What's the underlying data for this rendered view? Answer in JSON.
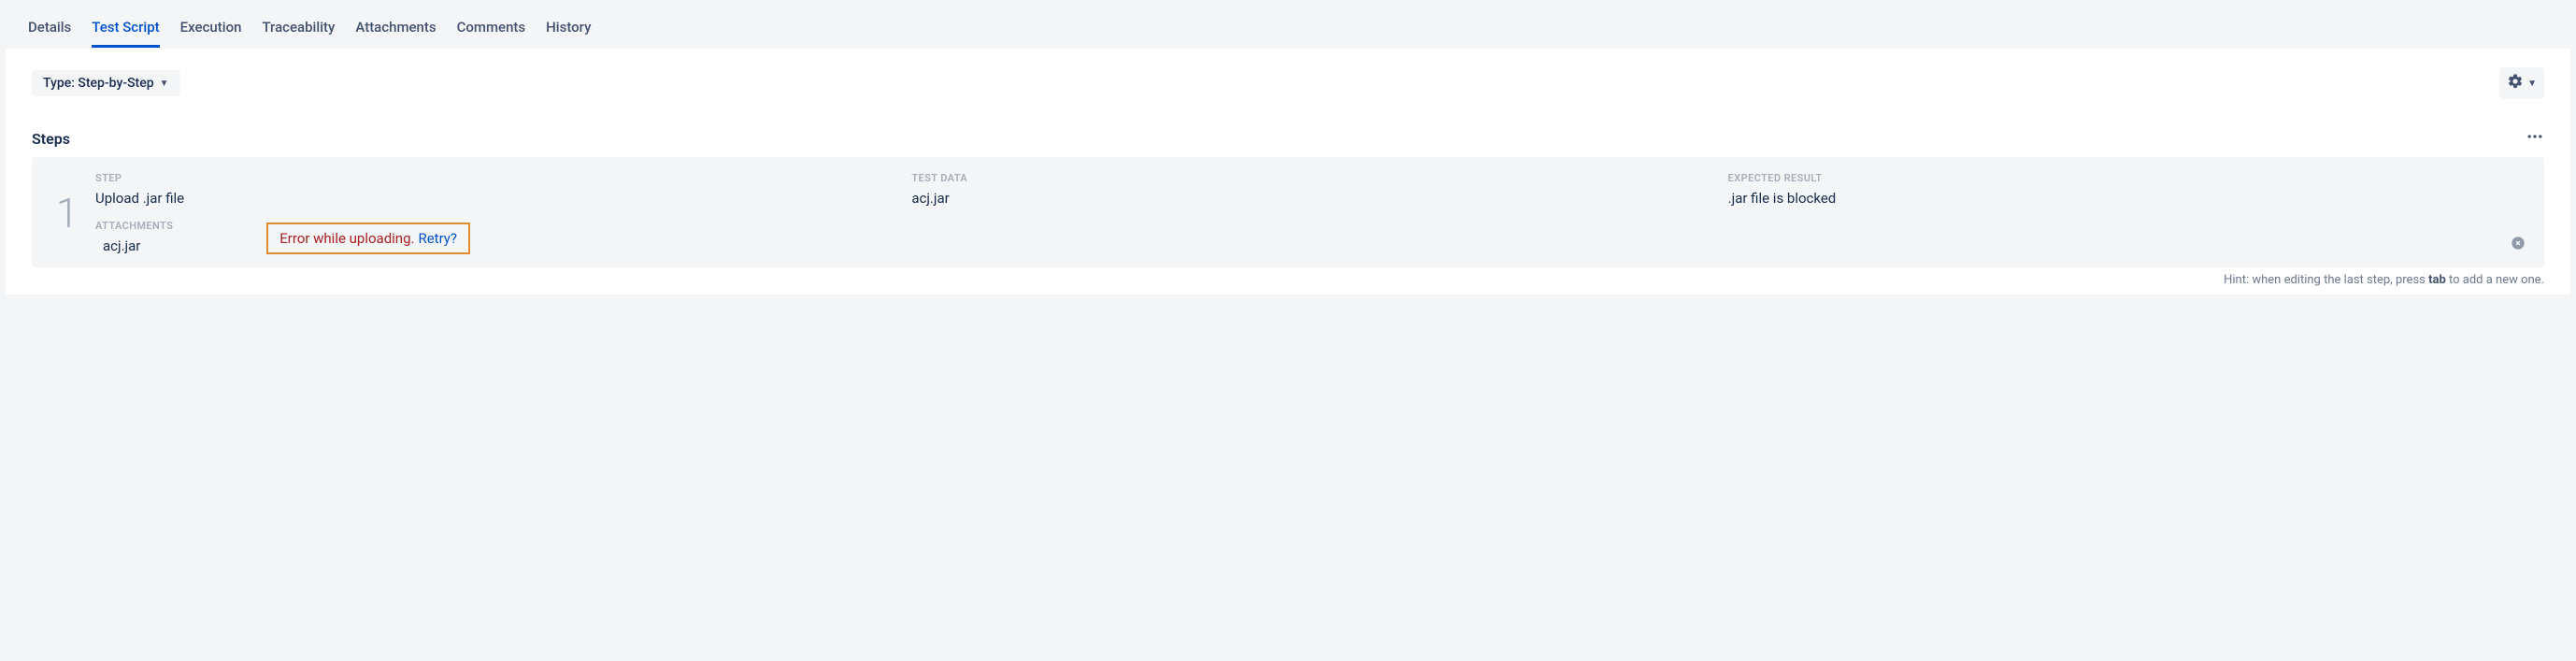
{
  "tabs": {
    "details": "Details",
    "test_script": "Test Script",
    "execution": "Execution",
    "traceability": "Traceability",
    "attachments": "Attachments",
    "comments": "Comments",
    "history": "History"
  },
  "toolbar": {
    "type_label": "Type: Step-by-Step"
  },
  "steps": {
    "heading": "Steps",
    "columns": {
      "step": "STEP",
      "test_data": "TEST DATA",
      "expected": "EXPECTED RESULT",
      "attachments": "ATTACHMENTS"
    },
    "row": {
      "num": "1",
      "step_text": "Upload .jar file",
      "test_data": "acj.jar",
      "expected": ".jar file is blocked",
      "attachment_name": "acj.jar"
    },
    "error": {
      "message": "Error while uploading.",
      "retry": "Retry?"
    }
  },
  "hint": {
    "prefix": "Hint: when editing the last step, press ",
    "key": "tab",
    "suffix": " to add a new one."
  }
}
